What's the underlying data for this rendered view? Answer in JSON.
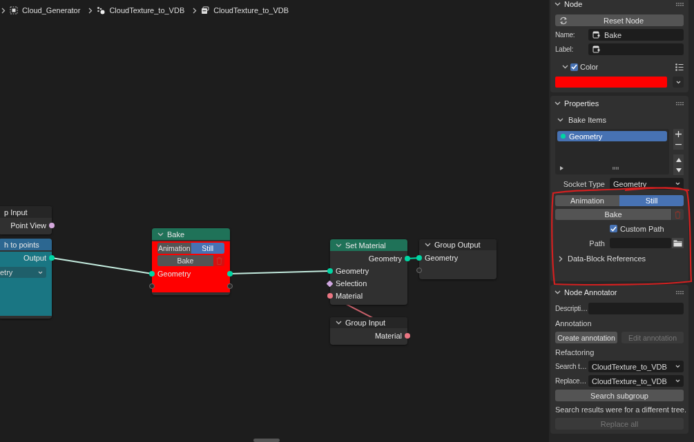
{
  "breadcrumbs": [
    {
      "kind": "scene",
      "label": "Cloud_Generator"
    },
    {
      "kind": "node_tree",
      "label": "CloudTexture_to_VDB"
    },
    {
      "kind": "group",
      "label": "CloudTexture_to_VDB"
    }
  ],
  "nodes": [
    {
      "title": "p Input",
      "color": "#262626",
      "collapsible": false,
      "rows": [
        {
          "kind": "socket",
          "label": "Point View",
          "output": {
            "kind": "circle",
            "color": "#d4a8dc"
          }
        }
      ]
    },
    {
      "title": "h to points",
      "color": "#2c6791",
      "body": {
        "color": "#1a7683"
      },
      "collapsible": false,
      "rows": [
        {
          "kind": "socket",
          "label": "Output",
          "output": {
            "kind": "circle",
            "color": "#00d6a3"
          }
        },
        {
          "kind": "dropdown",
          "label": "etry"
        }
      ]
    },
    {
      "title": "Bake",
      "color": "#1f7258",
      "body": {
        "color": "#ff0000"
      },
      "collapsible": true,
      "rows": [
        {
          "kind": "toggle",
          "options": [
            {
              "label": "Animation",
              "selected": false
            },
            {
              "label": "Still",
              "selected": true
            }
          ]
        },
        {
          "kind": "button",
          "label": "Bake"
        },
        {
          "kind": "socket",
          "label": "Geometry",
          "input": {
            "kind": "circle",
            "color": "#00d6a3"
          },
          "output": {
            "kind": "circle",
            "color": "#00d6a3"
          }
        },
        {
          "kind": "socket",
          "input": {
            "kind": "hollow"
          },
          "output": {
            "kind": "hollow"
          }
        }
      ]
    },
    {
      "title": "Set Material",
      "color": "#1f7258",
      "collapsible": true,
      "rows": [
        {
          "kind": "socket",
          "label": "Geometry",
          "output": {
            "kind": "circle",
            "color": "#00d6a3"
          }
        },
        {
          "kind": "socket",
          "label": "Geometry",
          "input": {
            "kind": "circle",
            "color": "#00d6a3"
          }
        },
        {
          "kind": "socket",
          "label": "Selection",
          "input": {
            "kind": "diamond",
            "color": "#cfa6e0"
          }
        },
        {
          "kind": "socket",
          "label": "Material",
          "input": {
            "kind": "circle",
            "color": "#eb7582"
          }
        }
      ]
    },
    {
      "title": "Group Output",
      "color": "#262626",
      "collapsible": true,
      "rows": [
        {
          "kind": "socket",
          "label": "Geometry",
          "input": {
            "kind": "circle",
            "color": "#00d6a3"
          }
        },
        {
          "kind": "socket",
          "input": {
            "kind": "hollow"
          }
        }
      ]
    },
    {
      "title": "Group Input",
      "color": "#262626",
      "collapsible": true,
      "rows": [
        {
          "kind": "socket",
          "label": "Material",
          "output": {
            "kind": "circle",
            "color": "#eb7582"
          }
        }
      ]
    }
  ],
  "links": [
    {
      "color": "#c4ecdf"
    },
    {
      "color": "#c4ecdf"
    },
    {
      "color": "#00d6a3"
    },
    {
      "color": "#c8606a"
    }
  ],
  "node_panel": {
    "title": "Node",
    "reset_button": "Reset Node",
    "name_field": {
      "label": "Name:",
      "value": "Bake"
    },
    "label_field": {
      "label": "Label:"
    },
    "color_setting": {
      "label": "Color",
      "checked": true,
      "expanded": true,
      "color": "#ff0000"
    }
  },
  "properties_panel": {
    "title": "Properties",
    "bake_items": {
      "title": "Bake Items",
      "expanded": true,
      "items": [
        {
          "label": "Geometry",
          "selected": true,
          "color": "#00d6a3"
        }
      ]
    },
    "socket_type": {
      "label": "Socket Type",
      "value": "Geometry"
    },
    "mode": [
      {
        "label": "Animation",
        "selected": false
      },
      {
        "label": "Still",
        "selected": true
      }
    ],
    "bake_button": "Bake",
    "custom_path": {
      "label": "Custom Path",
      "checked": true
    },
    "path": {
      "label": "Path"
    },
    "data_block": {
      "label": "Data-Block References",
      "expanded": false
    }
  },
  "annotator_panel": {
    "title": "Node Annotator",
    "description": {
      "label": "Descripti…"
    },
    "annotation_heading": "Annotation",
    "create_button": {
      "label": "Create annotation",
      "disabled": false
    },
    "edit_button": {
      "label": "Edit annotation",
      "disabled": true
    },
    "refactoring_heading": "Refactoring",
    "search_field": {
      "label": "Search t…",
      "value": "CloudTexture_to_VDB"
    },
    "replace_field": {
      "label": "Replace…",
      "value": "CloudTexture_to_VDB"
    },
    "search_button": "Search subgroup",
    "message": "Search results were for a different tree.",
    "replace_button": {
      "label": "Replace all",
      "disabled": true
    }
  }
}
